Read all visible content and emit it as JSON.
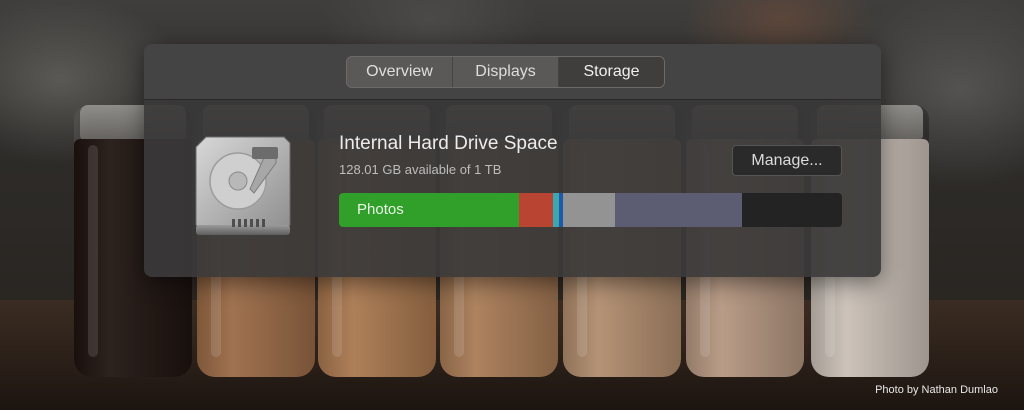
{
  "tabs": [
    {
      "label": "Overview",
      "active": false
    },
    {
      "label": "Displays",
      "active": false
    },
    {
      "label": "Storage",
      "active": true
    }
  ],
  "storage": {
    "title": "Internal Hard Drive Space",
    "subtitle": "128.01 GB available of 1 TB",
    "manage_label": "Manage...",
    "drive_icon": "hard-drive-icon",
    "segments": [
      {
        "label": "Photos",
        "color": "#30a02a",
        "fraction": 0.358
      },
      {
        "label": "",
        "color": "#b94432",
        "fraction": 0.068
      },
      {
        "label": "",
        "color": "#3ba7b1",
        "fraction": 0.012
      },
      {
        "label": "",
        "color": "#1f5aa8",
        "fraction": 0.008
      },
      {
        "label": "",
        "color": "#939393",
        "fraction": 0.104
      },
      {
        "label": "",
        "color": "#5c5c72",
        "fraction": 0.253
      }
    ],
    "free_color": "#242323"
  },
  "photo_credit": "Photo by Nathan Dumlao",
  "background_jars": [
    {
      "fill": "#1f1410"
    },
    {
      "fill": "#9a6a46"
    },
    {
      "fill": "#a9784f"
    },
    {
      "fill": "#a87b56"
    },
    {
      "fill": "#b08c6d"
    },
    {
      "fill": "#b49680"
    },
    {
      "fill": "#c9bfb6"
    }
  ]
}
